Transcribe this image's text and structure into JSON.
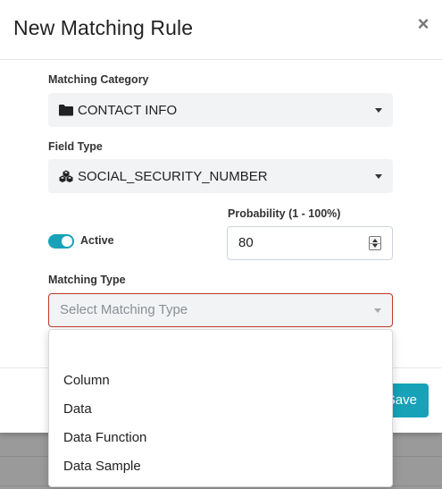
{
  "modal": {
    "title": "New Matching Rule",
    "close_label": "×"
  },
  "matching_category": {
    "label": "Matching Category",
    "value": "CONTACT INFO",
    "icon": "folder-icon"
  },
  "field_type": {
    "label": "Field Type",
    "value": "SOCIAL_SECURITY_NUMBER",
    "icon": "cubes-icon"
  },
  "active": {
    "label": "Active",
    "enabled": true
  },
  "probability": {
    "label": "Probability (1 - 100%)",
    "value": "80"
  },
  "matching_type": {
    "label": "Matching Type",
    "placeholder": "Select Matching Type",
    "options": [
      "",
      "Column",
      "Data",
      "Data Function",
      "Data Sample"
    ]
  },
  "footer": {
    "save_label": "Save"
  },
  "colors": {
    "accent": "#17a2b8",
    "invalid_border": "#c0392b",
    "select_bg": "#f1f3f5"
  }
}
